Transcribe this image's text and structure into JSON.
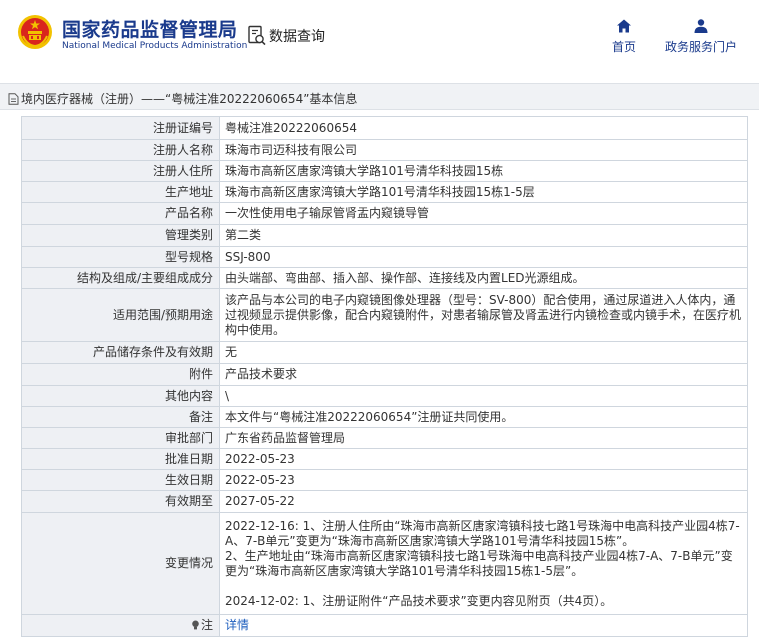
{
  "header": {
    "brand_cn": "国家药品监督管理局",
    "brand_en": "National Medical Products Administration",
    "query_label": "数据查询",
    "nav": {
      "home": "首页",
      "portal": "政务服务门户"
    }
  },
  "breadcrumb": "境内医疗器械（注册）——“粤械注准20222060654”基本信息",
  "fields": {
    "reg_no": {
      "label": "注册证编号",
      "value": "粤械注准20222060654"
    },
    "registrant": {
      "label": "注册人名称",
      "value": "珠海市司迈科技有限公司"
    },
    "address": {
      "label": "注册人住所",
      "value": "珠海市高新区唐家湾镇大学路101号清华科技园15栋"
    },
    "prod_addr": {
      "label": "生产地址",
      "value": "珠海市高新区唐家湾镇大学路101号清华科技园15栋1-5层"
    },
    "product": {
      "label": "产品名称",
      "value": "一次性使用电子输尿管肾盂内窥镜导管"
    },
    "category": {
      "label": "管理类别",
      "value": "第二类"
    },
    "model": {
      "label": "型号规格",
      "value": "SSJ-800"
    },
    "structure": {
      "label": "结构及组成/主要组成成分",
      "value": "由头端部、弯曲部、插入部、操作部、连接线及内置LED光源组成。"
    },
    "scope": {
      "label": "适用范围/预期用途",
      "value": "该产品与本公司的电子内窥镜图像处理器（型号：SV-800）配合使用，通过尿道进入人体内，通过视频显示提供影像，配合内窥镜附件，对患者输尿管及肾盂进行内镜检查或内镜手术，在医疗机构中使用。"
    },
    "storage": {
      "label": "产品储存条件及有效期",
      "value": "无"
    },
    "attachment": {
      "label": "附件",
      "value": "产品技术要求"
    },
    "other": {
      "label": "其他内容",
      "value": "\\"
    },
    "remark": {
      "label": "备注",
      "value": "本文件与“粤械注准20222060654”注册证共同使用。"
    },
    "dept": {
      "label": "审批部门",
      "value": "广东省药品监督管理局"
    },
    "approve_date": {
      "label": "批准日期",
      "value": "2022-05-23"
    },
    "effective_date": {
      "label": "生效日期",
      "value": "2022-05-23"
    },
    "expiry": {
      "label": "有效期至",
      "value": "2027-05-22"
    },
    "changes": {
      "label": "变更情况",
      "p1": "2022-12-16: 1、注册人住所由“珠海市高新区唐家湾镇科技七路1号珠海中电高科技产业园4栋7-A、7-B单元”变更为“珠海市高新区唐家湾镇大学路101号清华科技园15栋”。",
      "p2": "2、生产地址由“珠海市高新区唐家湾镇科技七路1号珠海中电高科技产业园4栋7-A、7-B单元”变更为“珠海市高新区唐家湾镇大学路101号清华科技园15栋1-5层”。",
      "p3": "2024-12-02: 1、注册证附件“产品技术要求”变更内容见附页（共4页）。"
    },
    "note": {
      "label": "注",
      "value": "详情"
    }
  },
  "colors": {
    "brand": "#1a3a8c",
    "emblem_red": "#d9251d",
    "emblem_gold": "#f2c200",
    "link": "#1f5fbf"
  }
}
